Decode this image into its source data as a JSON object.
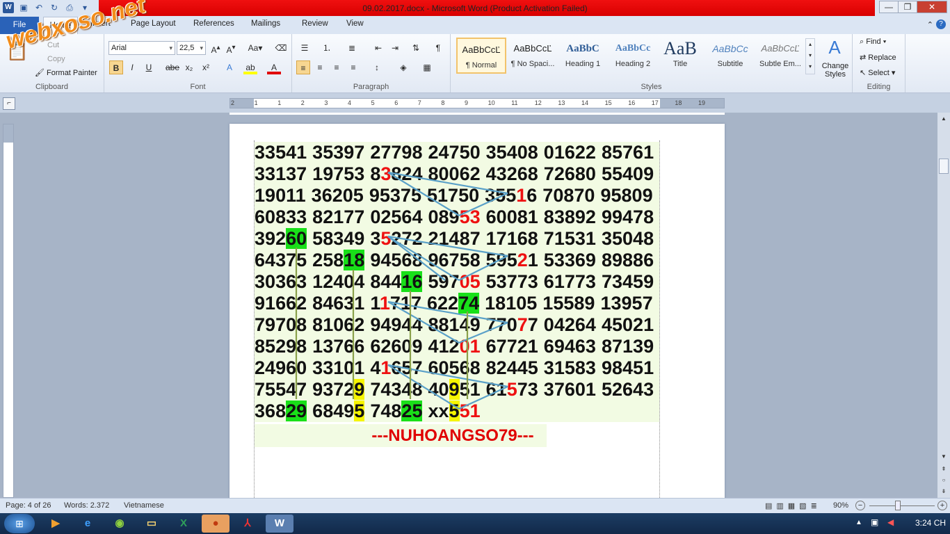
{
  "window": {
    "title": "09.02.2017.docx - Microsoft Word (Product Activation Failed)",
    "quick_access": [
      "word-icon",
      "save-icon",
      "undo-icon",
      "redo-icon",
      "print-preview-icon",
      "customize-icon"
    ],
    "buttons": {
      "minimize": "—",
      "restore": "❐",
      "close": "✕"
    }
  },
  "watermark": "webxoso.net",
  "tabs": [
    "File",
    "Home",
    "Insert",
    "Page Layout",
    "References",
    "Mailings",
    "Review",
    "View"
  ],
  "ribbon": {
    "clipboard": {
      "label": "Clipboard",
      "paste": "Paste",
      "cut": "Cut",
      "copy": "Copy",
      "format_painter": "Format Painter"
    },
    "font": {
      "label": "Font",
      "name": "Arial",
      "size": "22,5",
      "bold": "B",
      "italic": "I",
      "underline": "U",
      "strike": "abe",
      "sub": "x₂",
      "sup": "x²"
    },
    "paragraph": {
      "label": "Paragraph"
    },
    "styles": {
      "label": "Styles",
      "items": [
        {
          "preview": "AaBbCcĽ",
          "name": "¶ Normal"
        },
        {
          "preview": "AaBbCcĽ",
          "name": "¶ No Spaci..."
        },
        {
          "preview": "AaBbC",
          "name": "Heading 1"
        },
        {
          "preview": "AaBbCc",
          "name": "Heading 2"
        },
        {
          "preview": "AaB",
          "name": "Title"
        },
        {
          "preview": "AaBbCc",
          "name": "Subtitle"
        },
        {
          "preview": "AaBbCcĽ",
          "name": "Subtle Em..."
        }
      ],
      "change_styles": "Change Styles"
    },
    "editing": {
      "label": "Editing",
      "find": "Find",
      "replace": "Replace",
      "select": "Select"
    }
  },
  "ruler": {
    "numbers": [
      "2",
      "1",
      "1",
      "2",
      "3",
      "4",
      "5",
      "6",
      "7",
      "8",
      "9",
      "10",
      "11",
      "12",
      "13",
      "14",
      "15",
      "16",
      "17",
      "18",
      "19"
    ]
  },
  "document": {
    "rows": [
      [
        "33541",
        "35397",
        "27798",
        "24750",
        "35408",
        "01622",
        "85761"
      ],
      [
        "33137",
        "19753",
        "83824",
        "80062",
        "43268",
        "72680",
        "55409"
      ],
      [
        "19011",
        "36205",
        "95375",
        "51750",
        "35516",
        "70870",
        "95809"
      ],
      [
        "60833",
        "82177",
        "02564",
        "08953",
        "60081",
        "83892",
        "99478"
      ],
      [
        "39260",
        "58349",
        "35272",
        "21487",
        "17168",
        "71531",
        "35048"
      ],
      [
        "64375",
        "25818",
        "94568",
        "96758",
        "59521",
        "53369",
        "89886"
      ],
      [
        "30363",
        "12404",
        "84416",
        "59705",
        "53773",
        "61773",
        "73459"
      ],
      [
        "91662",
        "84631",
        "11717",
        "62274",
        "18105",
        "15589",
        "13957"
      ],
      [
        "79708",
        "81062",
        "94944",
        "88149",
        "77077",
        "04264",
        "45021"
      ],
      [
        "85298",
        "13766",
        "62609",
        "41201",
        "67721",
        "69463",
        "87139"
      ],
      [
        "24960",
        "33101",
        "41657",
        "60568",
        "82445",
        "31583",
        "98451"
      ],
      [
        "75547",
        "93729",
        "74348",
        "40951",
        "61573",
        "37601",
        "52643"
      ],
      [
        "36829",
        "68495",
        "74825",
        "xx551"
      ]
    ],
    "signature": "---NUHOANGSO79---"
  },
  "status": {
    "page": "Page: 4 of 26",
    "words": "Words: 2.372",
    "language": "Vietnamese",
    "zoom": "90%"
  },
  "taskbar": {
    "time": "3:24 CH",
    "apps": [
      "media-player-icon",
      "ie-icon",
      "chrome-icon",
      "explorer-icon",
      "excel-icon",
      "firefox-icon",
      "pdf-icon",
      "word-icon"
    ]
  },
  "colors": {
    "highlight_green": "#19e019",
    "highlight_yellow": "#f6f500",
    "digit_red": "#ee1111",
    "arrow_blue": "#5aa0c8",
    "arrow_olive": "#8aa04a"
  }
}
